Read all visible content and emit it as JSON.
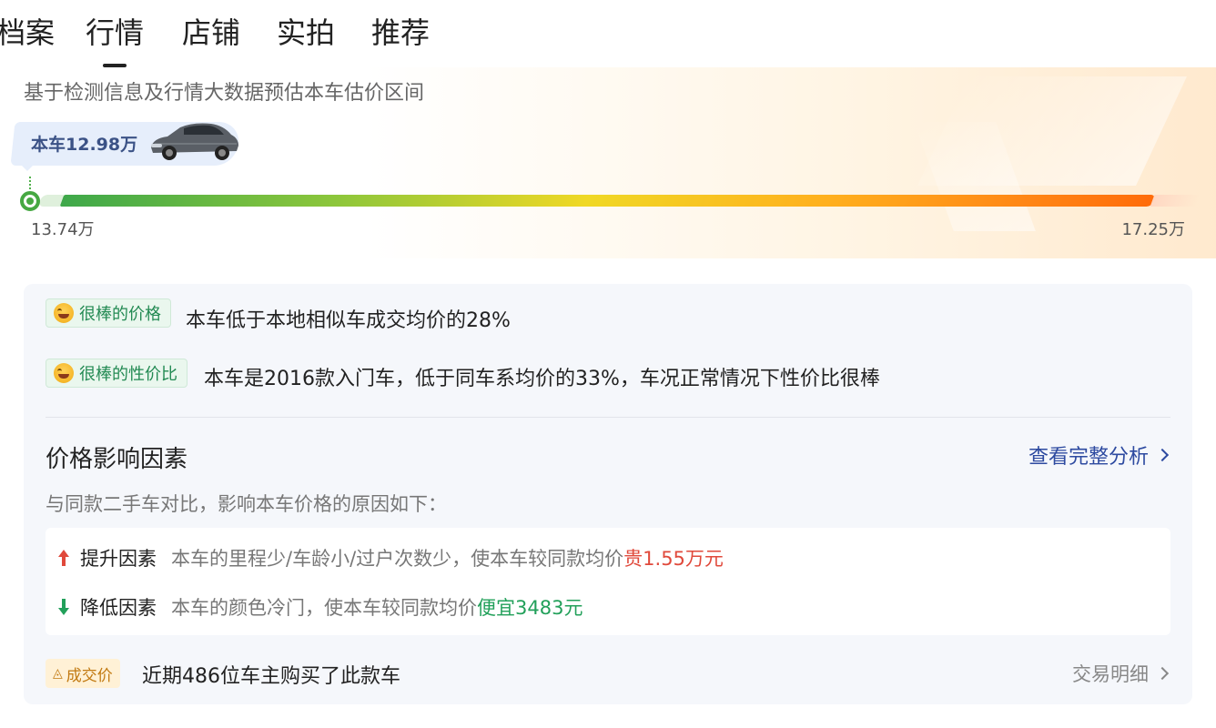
{
  "tabs": [
    {
      "label": "档案",
      "active": false
    },
    {
      "label": "行情",
      "active": true
    },
    {
      "label": "店铺",
      "active": false
    },
    {
      "label": "实拍",
      "active": false
    },
    {
      "label": "推荐",
      "active": false
    }
  ],
  "estimate": {
    "subtitle": "基于检测信息及行情大数据预估本车估价区间",
    "car_price_tag": "本车12.98万",
    "range_low": "13.74万",
    "range_high": "17.25万"
  },
  "highlights": [
    {
      "badge": "很棒的价格",
      "text": "本车低于本地相似车成交均价的28%"
    },
    {
      "badge": "很棒的性价比",
      "text": "本车是2016款入门车，低于同车系均价的33%，车况正常情况下性价比很棒"
    }
  ],
  "factors": {
    "title": "价格影响因素",
    "view_link": "查看完整分析",
    "desc": "与同款二手车对比，影响本车价格的原因如下：",
    "up": {
      "label": "提升因素",
      "desc": "本车的里程少/车龄小/过户次数少，使本车较同款均价",
      "highlight": "贵1.55万元"
    },
    "down": {
      "label": "降低因素",
      "desc": "本车的颜色冷门，使本车较同款均价",
      "highlight": "便宜3483元"
    }
  },
  "deal": {
    "badge": "成交价",
    "text": "近期486位车主购买了此款车",
    "link": "交易明细"
  },
  "colors": {
    "accent_blue": "#2d4aa0",
    "up_red": "#e0493b",
    "down_green": "#22a05a",
    "badge_green": "#238a53"
  }
}
